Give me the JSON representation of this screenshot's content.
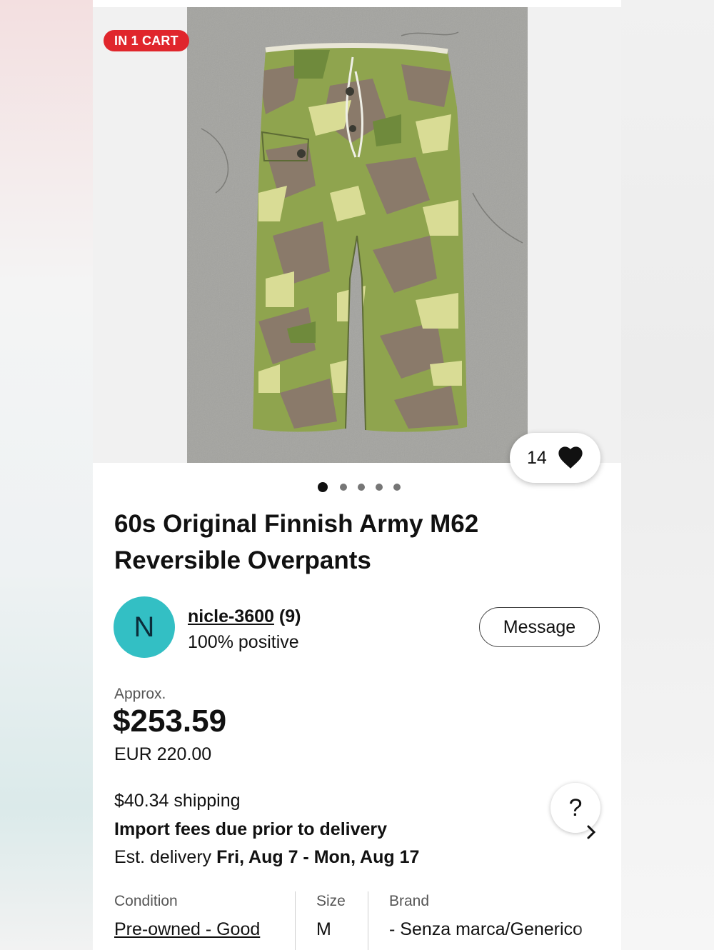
{
  "listing": {
    "cart_badge": "IN 1 CART",
    "watch_count": "14",
    "image_count": 5,
    "active_image": 1,
    "title": "60s Original Finnish Army M62 Reversible Overpants"
  },
  "seller": {
    "avatar_letter": "N",
    "avatar_color": "#33bfc4",
    "name": "nicle-3600",
    "feedback_count": "(9)",
    "positive": "100% positive",
    "message_label": "Message"
  },
  "price": {
    "approx_label": "Approx.",
    "value": "$253.59",
    "original": "EUR 220.00"
  },
  "shipping": {
    "cost": "$40.34 shipping",
    "import_fees": "Import fees due prior to delivery",
    "est_label": "Est. delivery",
    "est_dates": "Fri, Aug 7 - Mon, Aug 17",
    "help_label": "?"
  },
  "specs": {
    "condition_label": "Condition",
    "condition_value": "Pre-owned - Good",
    "size_label": "Size",
    "size_value": "M",
    "brand_label": "Brand",
    "brand_value": "- Senza marca/Generico"
  },
  "colors": {
    "badge_red": "#e0262c",
    "avatar_teal": "#33bfc4"
  },
  "icons": [
    "heart-icon",
    "chevron-right-icon",
    "help-icon"
  ]
}
